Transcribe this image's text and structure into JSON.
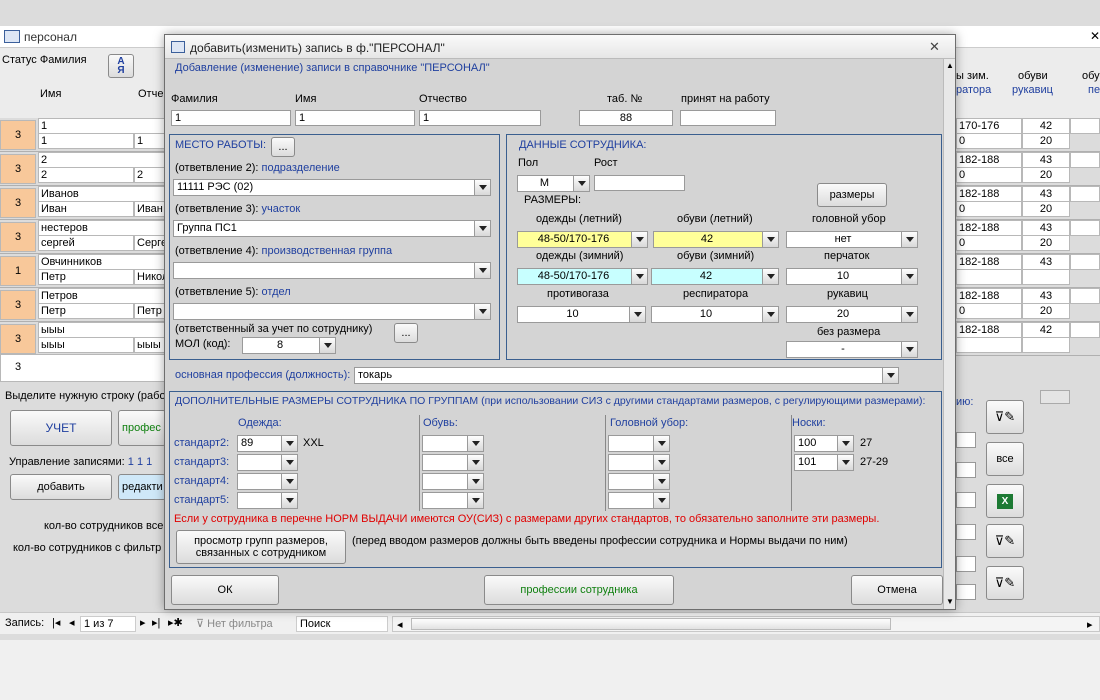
{
  "bg": {
    "window_title": "персонал",
    "col_status": "Статус",
    "col_surname": "Фамилия",
    "col_name": "Имя",
    "col_patronymic": "Отче",
    "col_size_winter": "ы зим.",
    "col_size_winter2": "ратора",
    "col_shoes": "обуви",
    "col_gloves": "рукавиц",
    "col_shoes2": "обу",
    "col_shoes2b": "пе",
    "rows": [
      {
        "status": "3",
        "surname": "1",
        "name": "1",
        "patr": "1",
        "size": "170-176",
        "a": "42",
        "b": "20",
        "size2": "0"
      },
      {
        "status": "3",
        "surname": "2",
        "name": "2",
        "patr": "2",
        "size": "182-188",
        "a": "43",
        "b": "20",
        "size2": "0"
      },
      {
        "status": "3",
        "surname": "Иванов",
        "name": "Иван",
        "patr": "Иван",
        "size": "182-188",
        "a": "43",
        "b": "20",
        "size2": "0"
      },
      {
        "status": "3",
        "surname": "нестеров",
        "name": "сергей",
        "patr": "Серге",
        "size": "182-188",
        "a": "43",
        "b": "20",
        "size2": "0"
      },
      {
        "status": "1",
        "surname": "Овчинников",
        "name": "Петр",
        "patr": "Никол",
        "size": "182-188",
        "a": "43",
        "b": "",
        "size2": ""
      },
      {
        "status": "3",
        "surname": "Петров",
        "name": "Петр",
        "patr": "Петр",
        "size": "182-188",
        "a": "43",
        "b": "20",
        "size2": "0"
      },
      {
        "status": "3",
        "surname": "ыыы",
        "name": "ыыы",
        "patr": "ыыы",
        "size": "182-188",
        "a": "42",
        "b": "",
        "size2": ""
      }
    ],
    "new_row_status": "3",
    "select_hint": "Выделите нужную строку (рабо",
    "btn_uchet": "УЧЕТ",
    "btn_profes": "профес",
    "manage_label": "Управление записями:",
    "manage_value": "1 1 1",
    "btn_add": "добавить",
    "btn_edit": "редакти",
    "count_all": "кол-во сотрудников все",
    "count_filter": "кол-во сотрудников с фильтр",
    "right_label": "ию:",
    "btn_all": "все",
    "nav_label": "Запись:",
    "nav_pos": "1 из 7",
    "nav_filter": "Нет фильтра",
    "nav_search": "Поиск"
  },
  "dlg": {
    "title": "добавить(изменить) запись в ф.\"ПЕРСОНАЛ\"",
    "subtitle": "Добавление (изменение) записи в справочнике \"ПЕРСОНАЛ\"",
    "lbl_surname": "Фамилия",
    "lbl_name": "Имя",
    "lbl_patr": "Отчество",
    "lbl_tab": "таб. №",
    "lbl_hired": "принят на работу",
    "val_surname": "1",
    "val_name": "1",
    "val_patr": "1",
    "val_tab": "88",
    "val_hired": "",
    "work": {
      "header": "МЕСТО РАБОТЫ:",
      "btn_more": "...",
      "b2": "(ответвление 2):",
      "b2_name": "подразделение",
      "b2_val": "11111 РЭС (02)",
      "b3": "(ответвление 3):",
      "b3_name": "участок",
      "b3_val": "Группа ПС1",
      "b4": "(ответвление 4):",
      "b4_name": "производственная группа",
      "b4_val": "",
      "b5": "(ответвление 5):",
      "b5_name": "отдел",
      "b5_val": "",
      "resp": "(ответственный за учет по сотруднику)",
      "mol_label": "МОЛ (код):",
      "mol_val": "8"
    },
    "emp": {
      "header": "ДАННЫЕ СОТРУДНИКА:",
      "lbl_sex": "Пол",
      "lbl_height": "Рост",
      "sex_val": "М",
      "height_val": "",
      "sizes_label": "РАЗМЕРЫ:",
      "btn_sizes": "размеры",
      "lbl_cloth_summer": "одежды (летний)",
      "lbl_shoes_summer": "обуви (летний)",
      "lbl_hat": "головной убор",
      "cloth_summer": "48-50/170-176",
      "shoes_summer": "42",
      "hat": "нет",
      "lbl_cloth_winter": "одежды (зимний)",
      "lbl_shoes_winter": "обуви (зимний)",
      "lbl_gloves": "перчаток",
      "cloth_winter": "48-50/170-176",
      "shoes_winter": "42",
      "gloves": "10",
      "lbl_gasmask": "противогаза",
      "lbl_resp": "респиратора",
      "lbl_mitt": "рукавиц",
      "gasmask": "10",
      "resp": "10",
      "mitt": "20",
      "lbl_nosize": "без размера",
      "nosize": "-"
    },
    "prof_label": "основная профессия (должность):",
    "prof_val": "токарь",
    "add": {
      "header": "ДОПОЛНИТЕЛЬНЫЕ РАЗМЕРЫ СОТРУДНИКА ПО ГРУППАМ (при использовании СИЗ с другими стандартами размеров, с регулирующими размерами):",
      "col_cloth": "Одежда:",
      "col_shoes": "Обувь:",
      "col_hat": "Головной убор:",
      "col_socks": "Носки:",
      "std2": "стандарт2:",
      "std3": "стандарт3:",
      "std4": "стандарт4:",
      "std5": "стандарт5:",
      "cloth2": "89",
      "cloth2_note": "XXL",
      "socks2": "100",
      "socks2_note": "27",
      "socks3": "101",
      "socks3_note": "27-29",
      "warning": "Если у сотрудника в перечне НОРМ ВЫДАЧИ имеются ОУ(СИЗ) с размерами других стандартов, то обязательно заполните эти размеры.",
      "btn_view": "просмотр групп размеров, связанных с сотрудником",
      "note": "(перед вводом размеров должны быть введены профессии сотрудника и Нормы выдачи по ним)"
    },
    "btn_ok": "ОК",
    "btn_profs": "профессии сотрудника",
    "btn_cancel": "Отмена"
  },
  "colors": {
    "yellow": "#ffff99",
    "cyan": "#c8ffff",
    "status_orange": "#f8c89a",
    "group_border": "#3a5f8f"
  }
}
